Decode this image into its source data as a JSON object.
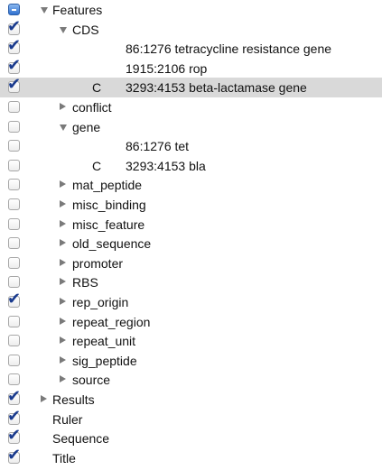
{
  "tree": [
    {
      "label": "Features",
      "level": 0,
      "toggle": "open",
      "check": "mixed"
    },
    {
      "label": "CDS",
      "level": 1,
      "toggle": "open",
      "check": "checked"
    },
    {
      "label": "86:1276 tetracycline resistance gene",
      "level": 2,
      "toggle": "none",
      "check": "checked",
      "strand": ""
    },
    {
      "label": "1915:2106 rop",
      "level": 2,
      "toggle": "none",
      "check": "checked",
      "strand": ""
    },
    {
      "label": "3293:4153 beta-lactamase gene",
      "level": 2,
      "toggle": "none",
      "check": "checked",
      "strand": "C",
      "selected": true
    },
    {
      "label": "conflict",
      "level": 1,
      "toggle": "closed",
      "check": "unchecked"
    },
    {
      "label": "gene",
      "level": 1,
      "toggle": "open",
      "check": "unchecked"
    },
    {
      "label": "86:1276 tet",
      "level": 2,
      "toggle": "none",
      "check": "unchecked",
      "strand": ""
    },
    {
      "label": "3293:4153 bla",
      "level": 2,
      "toggle": "none",
      "check": "unchecked",
      "strand": "C"
    },
    {
      "label": "mat_peptide",
      "level": 1,
      "toggle": "closed",
      "check": "unchecked"
    },
    {
      "label": "misc_binding",
      "level": 1,
      "toggle": "closed",
      "check": "unchecked"
    },
    {
      "label": "misc_feature",
      "level": 1,
      "toggle": "closed",
      "check": "unchecked"
    },
    {
      "label": "old_sequence",
      "level": 1,
      "toggle": "closed",
      "check": "unchecked"
    },
    {
      "label": "promoter",
      "level": 1,
      "toggle": "closed",
      "check": "unchecked"
    },
    {
      "label": "RBS",
      "level": 1,
      "toggle": "closed",
      "check": "unchecked"
    },
    {
      "label": "rep_origin",
      "level": 1,
      "toggle": "closed",
      "check": "checked"
    },
    {
      "label": "repeat_region",
      "level": 1,
      "toggle": "closed",
      "check": "unchecked"
    },
    {
      "label": "repeat_unit",
      "level": 1,
      "toggle": "closed",
      "check": "unchecked"
    },
    {
      "label": "sig_peptide",
      "level": 1,
      "toggle": "closed",
      "check": "unchecked"
    },
    {
      "label": "source",
      "level": 1,
      "toggle": "closed",
      "check": "unchecked"
    },
    {
      "label": "Results",
      "level": 0,
      "toggle": "closed",
      "check": "checked"
    },
    {
      "label": "Ruler",
      "level": 0,
      "toggle": "none",
      "check": "checked"
    },
    {
      "label": "Sequence",
      "level": 0,
      "toggle": "none",
      "check": "checked"
    },
    {
      "label": "Title",
      "level": 0,
      "toggle": "none",
      "check": "checked"
    }
  ],
  "colors": {
    "selected_row": "#d9d9d9",
    "check_mark": "#1a3b8e",
    "mixed_fill": "#2e6fce",
    "triangle": "#7a7a7a"
  },
  "icons": {
    "open": "disclosure-triangle-open-icon",
    "closed": "disclosure-triangle-closed-icon"
  }
}
